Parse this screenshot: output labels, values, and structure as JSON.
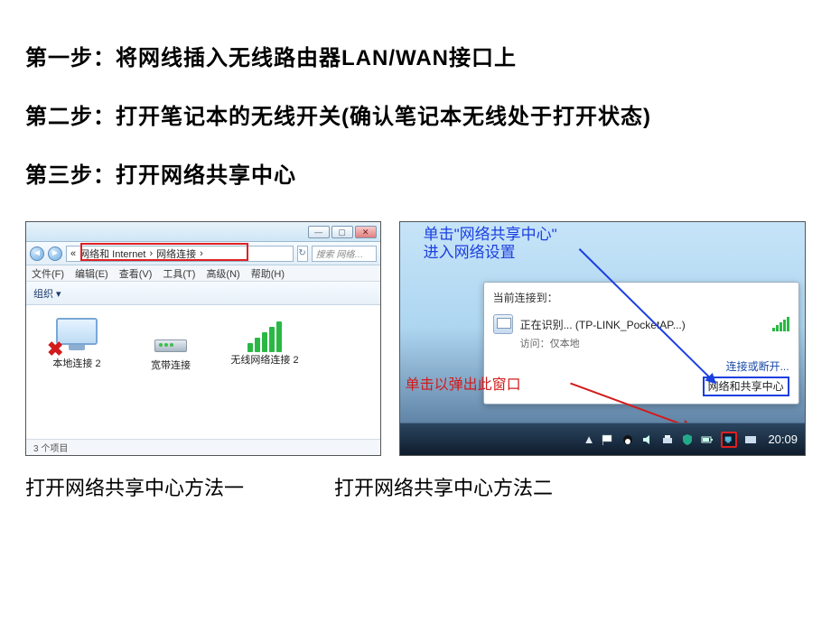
{
  "steps": {
    "s1": "第一步：将网线插入无线路由器LAN/WAN接口上",
    "s2": "第二步：打开笔记本的无线开关(确认笔记本无线处于打开状态)",
    "s3": "第三步：打开网络共享中心"
  },
  "shotA": {
    "breadcrumb_prefix": "«",
    "breadcrumb_seg1": "网络和 Internet",
    "breadcrumb_seg2": "网络连接",
    "search_placeholder": "搜索 网络…",
    "menu": {
      "file": "文件(F)",
      "edit": "编辑(E)",
      "view": "查看(V)",
      "tools": "工具(T)",
      "advanced": "高级(N)",
      "help": "帮助(H)"
    },
    "toolbar_organize": "组织 ▾",
    "conn1": "本地连接 2",
    "conn2": "宽带连接",
    "conn3": "无线网络连接 2",
    "status": "3 个项目"
  },
  "shotB": {
    "anno_blue_line1": "单击\"网络共享中心\"",
    "anno_blue_line2": "进入网络设置",
    "popup_header": "当前连接到：",
    "popup_conn_name": "正在识别... (TP-LINK_PocketAP...)",
    "popup_access": "访问：仅本地",
    "popup_link_disconnect": "连接或断开...",
    "popup_link_center": "网络和共享中心",
    "anno_red": "单击以弹出此窗口",
    "clock": "20:09",
    "tray_chevron": "▲"
  },
  "captions": {
    "a": "打开网络共享中心方法一",
    "b": "打开网络共享中心方法二"
  }
}
